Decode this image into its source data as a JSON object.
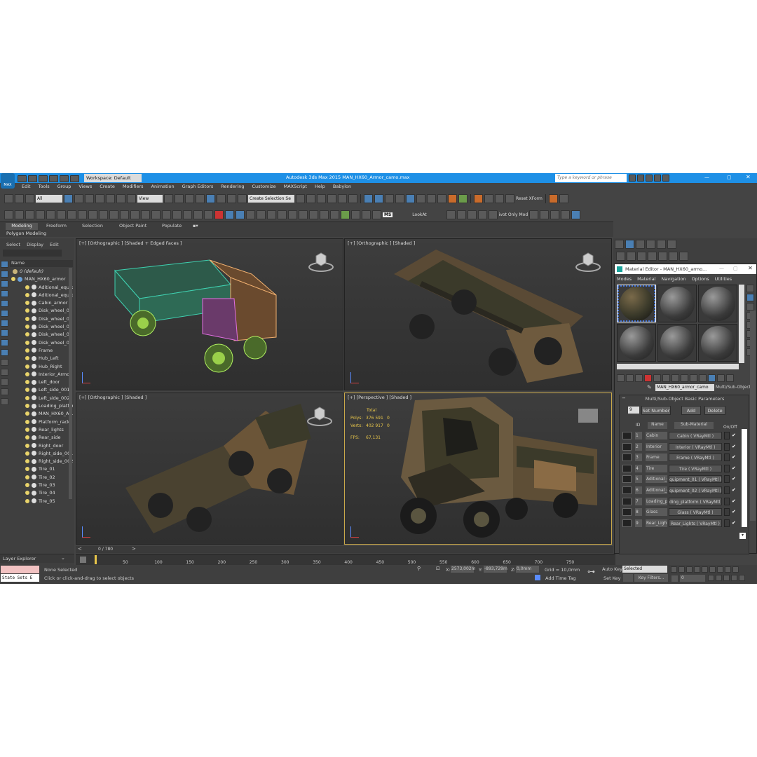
{
  "window": {
    "title": "Autodesk 3ds Max 2015    MAN_HX60_Armor_camo.max",
    "search_placeholder": "Type a keyword or phrase",
    "workspace": "Workspace: Default",
    "app_badge": "MAX"
  },
  "menu": [
    "Edit",
    "Tools",
    "Group",
    "Views",
    "Create",
    "Modifiers",
    "Animation",
    "Graph Editors",
    "Rendering",
    "Customize",
    "MAXScript",
    "Help",
    "Babylon"
  ],
  "toolbar": {
    "filter": "All",
    "view": "View",
    "selection_set": "Create Selection Se",
    "reset_xform": "Reset XForm",
    "look_at": "LookAt",
    "pivot_only": "ivot Only Mod",
    "ms_label": "MS"
  },
  "ribbon": {
    "tabs": [
      "Modeling",
      "Freeform",
      "Selection",
      "Object Paint",
      "Populate"
    ],
    "subtitle": "Polygon Modeling"
  },
  "scene_explorer": {
    "menu": [
      "Select",
      "Display",
      "Edit"
    ],
    "header": "Name",
    "root": "0 (default)",
    "group": "MAN_HX60_armor",
    "items": [
      "Aditional_equip...",
      "Aditional_equip...",
      "Cabin_armor",
      "Disk_wheel_01",
      "Disk_wheel_02",
      "Disk_wheel_03",
      "Disk_wheel_04",
      "Disk_wheel_05",
      "Frame",
      "Hub_Left",
      "Hub_Right",
      "Interior_Armor...",
      "Left_door",
      "Left_side_001",
      "Left_side_002",
      "Loading_platfor...",
      "MAN_HX60_Ar...",
      "Platform_rack",
      "Rear_lights",
      "Rear_side",
      "Right_door",
      "Right_side_001",
      "Right_side_002",
      "Tire_01",
      "Tire_02",
      "Tire_03",
      "Tire_04",
      "Tire_05"
    ],
    "footer": "Layer Explorer"
  },
  "viewports": {
    "top_left": "[+] [Orthographic ] [Shaded + Edged Faces ]",
    "top_right": "[+] [Orthographic ] [Shaded ]",
    "bottom_left": "[+] [Orthographic ] [Shaded ]",
    "bottom_right": "[+] [Perspective ] [Shaded ]"
  },
  "stats": {
    "total_label": "Total",
    "polys_label": "Polys:",
    "polys": "376 591",
    "polys_sel": "0",
    "verts_label": "Verts:",
    "verts": "402 917",
    "verts_sel": "0",
    "fps_label": "FPS:",
    "fps": "67,131"
  },
  "timeline": {
    "frame": "0 / 780",
    "ticks": [
      "50",
      "100",
      "150",
      "200",
      "250",
      "300",
      "350",
      "400",
      "450",
      "500",
      "550",
      "600",
      "650",
      "700",
      "750"
    ]
  },
  "status": {
    "state_sets": "State Sets E",
    "selection": "None Selected",
    "prompt": "Click or click-and-drag to select objects",
    "x_label": "X:",
    "x": "2573,002m",
    "y_label": "Y:",
    "y": "-893,729m",
    "z_label": "Z:",
    "z": "0,0mm",
    "grid": "Grid = 10,0mm",
    "add_time_tag": "Add Time Tag",
    "auto_key": "Auto Key",
    "selected": "Selected",
    "set_key": "Set Key",
    "key_filters": "Key Filters...",
    "frame_field": "0"
  },
  "material_editor": {
    "title": "Material Editor - MAN_HX60_armo...",
    "menu": [
      "Modes",
      "Material",
      "Navigation",
      "Options",
      "Utilities"
    ],
    "material_name": "MAN_HX60_armor_camo",
    "material_type": "Multi/Sub-Object",
    "rollout": "Multi/Sub-Object Basic Parameters",
    "count": "9",
    "set_number": "Set Number",
    "add": "Add",
    "delete": "Delete",
    "col_id": "ID",
    "col_name": "Name",
    "col_sub": "Sub-Material",
    "col_onoff": "On/Off",
    "rows": [
      {
        "id": "1",
        "name": "Cabin",
        "sub": "Cabin  ( VRayMtl )"
      },
      {
        "id": "2",
        "name": "Interior",
        "sub": "Interior  ( VRayMtl )"
      },
      {
        "id": "3",
        "name": "Frame",
        "sub": "Frame  ( VRayMtl )"
      },
      {
        "id": "4",
        "name": "Tire",
        "sub": "Tire  ( VRayMtl )"
      },
      {
        "id": "5",
        "name": "Aditional_e",
        "sub": "quipment_01  ( VRayMtl )"
      },
      {
        "id": "6",
        "name": "Aditional_e",
        "sub": "quipment_02  ( VRayMtl )"
      },
      {
        "id": "7",
        "name": "Loading_pl",
        "sub": "ding_platform  ( VRayMtl )"
      },
      {
        "id": "8",
        "name": "Glass",
        "sub": "Glass  ( VRayMtl )"
      },
      {
        "id": "9",
        "name": "Rear_Light",
        "sub": "Rear_Lights  ( VRayMtl )"
      }
    ]
  },
  "colors": {
    "title_bar": "#1e90e6",
    "accent": "#2d7fd3",
    "viewport_active": "#c9a84a",
    "camo_dark": "#3b3a2a",
    "camo_tan": "#8a6b45"
  }
}
